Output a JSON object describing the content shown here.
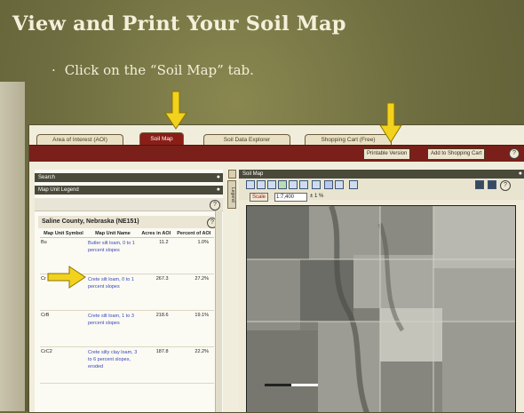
{
  "slide": {
    "title": "View and Print Your Soil Map",
    "bullet": "Click on the “Soil Map” tab.",
    "bullet_marker": "·"
  },
  "tabs": [
    {
      "label": "Area of Interest (AOI)"
    },
    {
      "label": "Soil Map"
    },
    {
      "label": "Soil Data Explorer"
    },
    {
      "label": "Shopping Cart (Free)"
    }
  ],
  "toolbar": {
    "printable_label": "Printable Version",
    "cart_label": "Add to Shopping Cart",
    "help_glyph": "?"
  },
  "left_panel": {
    "search_label": "Search",
    "legend_label": "Map Unit Legend",
    "county": "Saline County, Nebraska (NE151)",
    "columns": [
      "Map Unit Symbol",
      "Map Unit Name",
      "Acres in AOI",
      "Percent of AOI"
    ],
    "rows": [
      {
        "symbol": "Bu",
        "name": "Butler silt loam, 0 to 1 percent slopes",
        "acres": "11.2",
        "percent": "1.0%"
      },
      {
        "symbol": "Cr",
        "name": "Crete silt loam, 0 to 1 percent slopes",
        "acres": "267.3",
        "percent": "27.2%"
      },
      {
        "symbol": "CrB",
        "name": "Crete silt loam, 1 to 3 percent slopes",
        "acres": "218.6",
        "percent": "19.1%"
      },
      {
        "symbol": "CrC2",
        "name": "Crete silty clay loam, 3 to 6 percent slopes, eroded",
        "acres": "187.8",
        "percent": "22.2%"
      }
    ]
  },
  "legend_tab": "Legend",
  "map_panel": {
    "title": "Soil Map",
    "scale_button": "Scale",
    "scale_value": "1:7,400",
    "zoom_label": "± 1 %"
  },
  "colors": {
    "accent": "#8b1d17",
    "arrow": "#f2d21c",
    "link": "#3b48b8"
  }
}
